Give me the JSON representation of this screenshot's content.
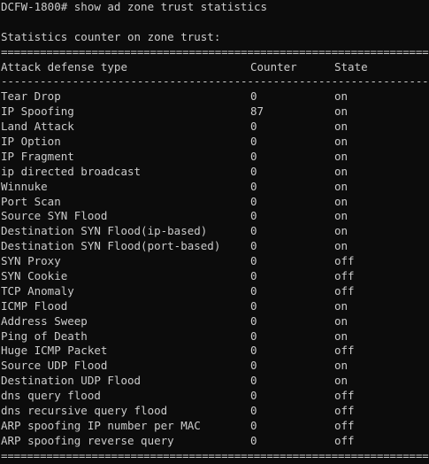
{
  "prompt": "DCFW-1800# show ad zone trust statistics",
  "heading": "Statistics counter on zone trust:",
  "rule_double": "====================================================================",
  "rule_single": "--------------------------------------------------------------------",
  "columns": {
    "type": "Attack defense type",
    "counter": "Counter",
    "state": "State"
  },
  "rows": [
    {
      "type": "Tear Drop",
      "counter": "0",
      "state": "on"
    },
    {
      "type": "IP Spoofing",
      "counter": "87",
      "state": "on"
    },
    {
      "type": "Land Attack",
      "counter": "0",
      "state": "on"
    },
    {
      "type": "IP Option",
      "counter": "0",
      "state": "on"
    },
    {
      "type": "IP Fragment",
      "counter": "0",
      "state": "on"
    },
    {
      "type": "ip directed broadcast",
      "counter": "0",
      "state": "on"
    },
    {
      "type": "Winnuke",
      "counter": "0",
      "state": "on"
    },
    {
      "type": "Port Scan",
      "counter": "0",
      "state": "on"
    },
    {
      "type": "Source SYN Flood",
      "counter": "0",
      "state": "on"
    },
    {
      "type": "Destination SYN Flood(ip-based)",
      "counter": "0",
      "state": "on"
    },
    {
      "type": "Destination SYN Flood(port-based)",
      "counter": "0",
      "state": "on"
    },
    {
      "type": "SYN Proxy",
      "counter": "0",
      "state": "off"
    },
    {
      "type": "SYN Cookie",
      "counter": "0",
      "state": "off"
    },
    {
      "type": "TCP Anomaly",
      "counter": "0",
      "state": "off"
    },
    {
      "type": "ICMP Flood",
      "counter": "0",
      "state": "on"
    },
    {
      "type": "Address Sweep",
      "counter": "0",
      "state": "on"
    },
    {
      "type": "Ping of Death",
      "counter": "0",
      "state": "on"
    },
    {
      "type": "Huge ICMP Packet",
      "counter": "0",
      "state": "off"
    },
    {
      "type": "Source UDP Flood",
      "counter": "0",
      "state": "on"
    },
    {
      "type": "Destination UDP Flood",
      "counter": "0",
      "state": "on"
    },
    {
      "type": "dns query flood",
      "counter": "0",
      "state": "off"
    },
    {
      "type": "dns recursive query flood",
      "counter": "0",
      "state": "off"
    },
    {
      "type": "ARP spoofing IP number per MAC",
      "counter": "0",
      "state": "off"
    },
    {
      "type": "ARP spoofing reverse query",
      "counter": "0",
      "state": "off"
    }
  ]
}
